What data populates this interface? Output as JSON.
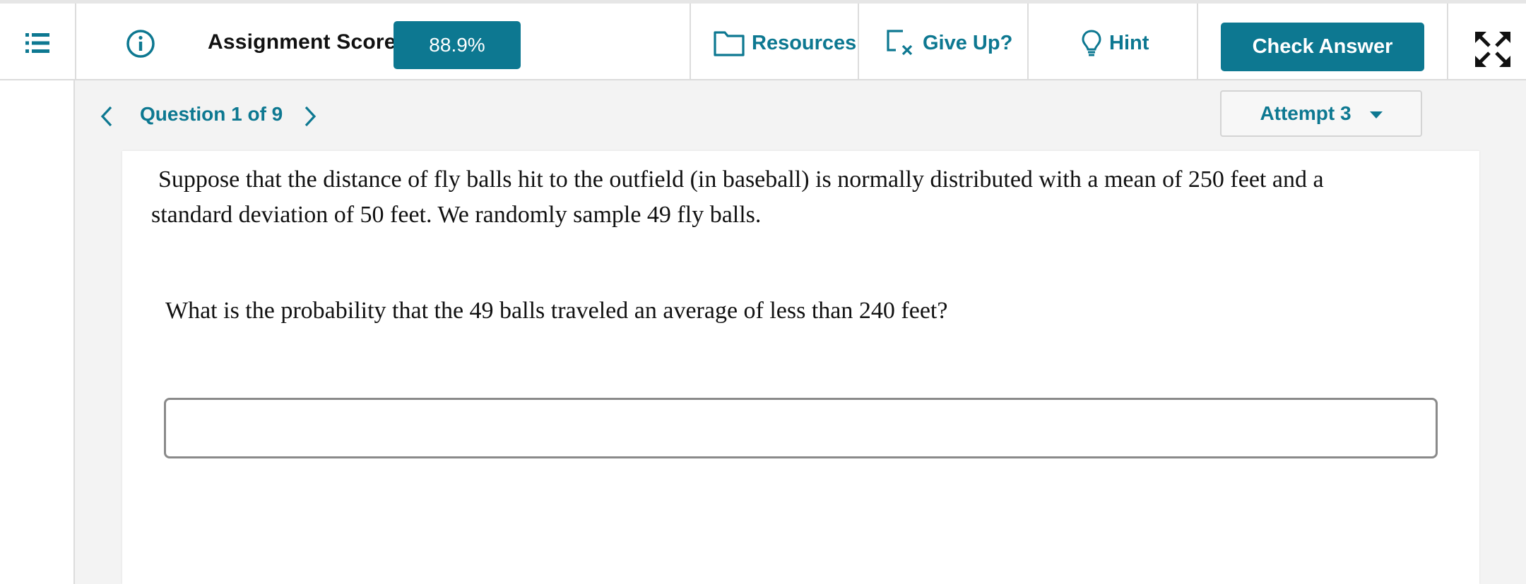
{
  "header": {
    "menu_icon": "list-icon",
    "info_icon": "info-circle-icon",
    "score_label": "Assignment Score:",
    "score_value": "88.9%",
    "resources_label": "Resources",
    "resources_icon": "folder-icon",
    "giveup_label": "Give Up?",
    "giveup_icon": "give-up-icon",
    "hint_label": "Hint",
    "hint_icon": "lightbulb-icon",
    "check_answer_label": "Check Answer",
    "expand_icon": "expand-arrows-icon",
    "accent_color": "#0d7891"
  },
  "question_nav": {
    "label": "Question 1 of 9",
    "prev_icon": "chevron-left-icon",
    "next_icon": "chevron-right-icon",
    "attempt_label": "Attempt 3",
    "attempt_caret_icon": "caret-down-icon"
  },
  "problem": {
    "line1": "Suppose that the distance of fly balls hit to the outfield (in baseball)  is normally distributed with a mean of 250 feet and a",
    "line2": "standard  deviation of 50 feet. We randomly sample 49 fly balls.",
    "question": "What is the probability that the 49 balls traveled an average of less than 240 feet?",
    "answer_value": ""
  }
}
